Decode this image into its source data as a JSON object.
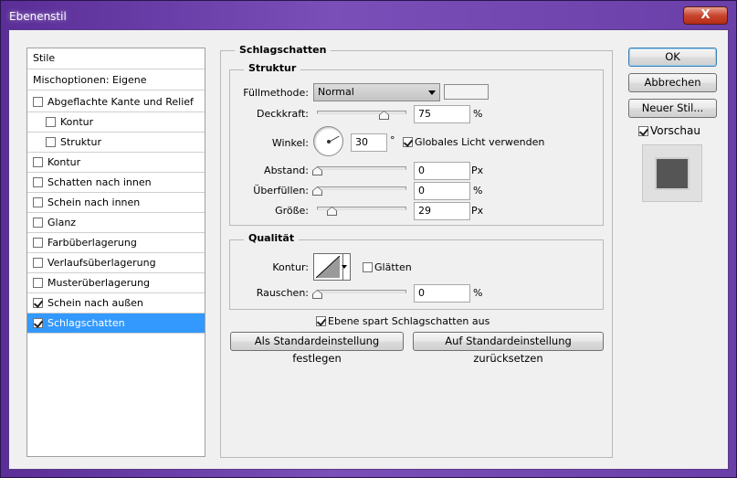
{
  "window": {
    "title": "Ebenenstil",
    "close_label": "X"
  },
  "styles_list": {
    "header": "Stile",
    "blend_options": "Mischoptionen: Eigene",
    "items": [
      {
        "label": "Abgeflachte Kante und Relief",
        "checked": false,
        "indent": 0
      },
      {
        "label": "Kontur",
        "checked": false,
        "indent": 1
      },
      {
        "label": "Struktur",
        "checked": false,
        "indent": 1
      },
      {
        "label": "Kontur",
        "checked": false,
        "indent": 0
      },
      {
        "label": "Schatten nach innen",
        "checked": false,
        "indent": 0
      },
      {
        "label": "Schein nach innen",
        "checked": false,
        "indent": 0
      },
      {
        "label": "Glanz",
        "checked": false,
        "indent": 0
      },
      {
        "label": "Farbüberlagerung",
        "checked": false,
        "indent": 0
      },
      {
        "label": "Verlaufsüberlagerung",
        "checked": false,
        "indent": 0
      },
      {
        "label": "Musterüberlagerung",
        "checked": false,
        "indent": 0
      },
      {
        "label": "Schein nach außen",
        "checked": true,
        "indent": 0
      },
      {
        "label": "Schlagschatten",
        "checked": true,
        "indent": 0,
        "selected": true
      }
    ]
  },
  "panel": {
    "title": "Schlagschatten",
    "structure": {
      "title": "Struktur",
      "blend_mode_label": "Füllmethode:",
      "blend_mode_value": "Normal",
      "opacity_label": "Deckkraft:",
      "opacity_value": "75",
      "opacity_unit": "%",
      "opacity_level": 0.75,
      "angle_label": "Winkel:",
      "angle_value": "30",
      "angle_unit": "°",
      "global_light_label": "Globales Licht verwenden",
      "global_light_checked": true,
      "distance_label": "Abstand:",
      "distance_value": "0",
      "distance_unit": "Px",
      "spread_label": "Überfüllen:",
      "spread_value": "0",
      "spread_unit": "%",
      "size_label": "Größe:",
      "size_value": "29",
      "size_unit": "Px"
    },
    "quality": {
      "title": "Qualität",
      "contour_label": "Kontur:",
      "antialias_label": "Glätten",
      "antialias_checked": false,
      "noise_label": "Rauschen:",
      "noise_value": "0",
      "noise_unit": "%"
    },
    "knockout_label": "Ebene spart Schlagschatten aus",
    "knockout_checked": true,
    "make_default_label": "Als Standardeinstellung festlegen",
    "reset_default_label": "Auf Standardeinstellung zurücksetzen"
  },
  "buttons": {
    "ok": "OK",
    "cancel": "Abbrechen",
    "new_style": "Neuer Stil...",
    "preview_label": "Vorschau",
    "preview_checked": true
  },
  "colors": {
    "title_bar": "#6a3fa8",
    "selection": "#3399ff",
    "close_button": "#c9452e"
  }
}
